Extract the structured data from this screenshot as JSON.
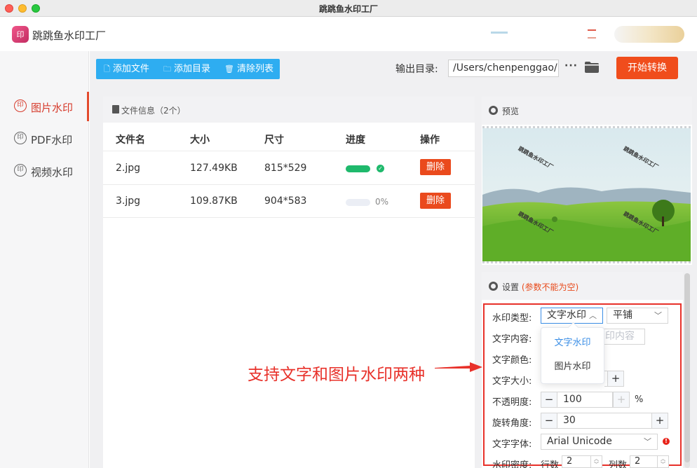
{
  "window": {
    "title": "跳跳鱼水印工厂"
  },
  "app": {
    "name": "跳跳鱼水印工厂",
    "logo_icon": "stamp-icon"
  },
  "sidebar": {
    "items": [
      {
        "label": "图片水印",
        "icon": "stamp-icon",
        "active": true
      },
      {
        "label": "PDF水印",
        "icon": "stamp-icon",
        "active": false
      },
      {
        "label": "视频水印",
        "icon": "stamp-icon",
        "active": false
      }
    ]
  },
  "toolbar": {
    "add_file": "添加文件",
    "add_folder": "添加目录",
    "clear_list": "清除列表"
  },
  "output": {
    "label": "输出目录:",
    "path": "/Users/chenpenggao/D",
    "more": "···",
    "start_button": "开始转换"
  },
  "file_panel": {
    "title": "文件信息（2个）",
    "columns": [
      "文件名",
      "大小",
      "尺寸",
      "进度",
      "操作"
    ],
    "rows": [
      {
        "name": "2.jpg",
        "size": "127.49KB",
        "dimensions": "815*529",
        "progress": 1.0,
        "progress_label": "",
        "action": "删除"
      },
      {
        "name": "3.jpg",
        "size": "109.87KB",
        "dimensions": "904*583",
        "progress": 0.0,
        "progress_label": "0%",
        "action": "删除"
      }
    ]
  },
  "preview": {
    "title": "预览",
    "watermark_text": "跳跳鱼水印工厂"
  },
  "settings": {
    "title": "设置",
    "warning": "(参数不能为空)",
    "fields": {
      "wm_type_label": "水印类型:",
      "wm_type_value": "文字水印",
      "layout_value": "平铺",
      "text_content_label": "文字内容:",
      "text_content_placeholder": "印内容",
      "text_color_label": "文字颜色:",
      "text_size_label": "文字大小:",
      "opacity_label": "不透明度:",
      "opacity_value": "100",
      "opacity_unit": "%",
      "rotation_label": "旋转角度:",
      "rotation_value": "30",
      "font_label": "文字字体:",
      "font_value": "Arial Unicode",
      "density_label": "水印密度:",
      "rows_label": "行数",
      "rows_value": "2",
      "cols_label": "列数",
      "cols_value": "2"
    },
    "dropdown_options": [
      "文字水印",
      "图片水印"
    ]
  },
  "annotation": {
    "text": "支持文字和图片水印两种"
  },
  "colors": {
    "accent": "#f04d1c",
    "primary_blue": "#2eadf1",
    "success": "#1fb96c",
    "annotation_red": "#e8312a"
  }
}
